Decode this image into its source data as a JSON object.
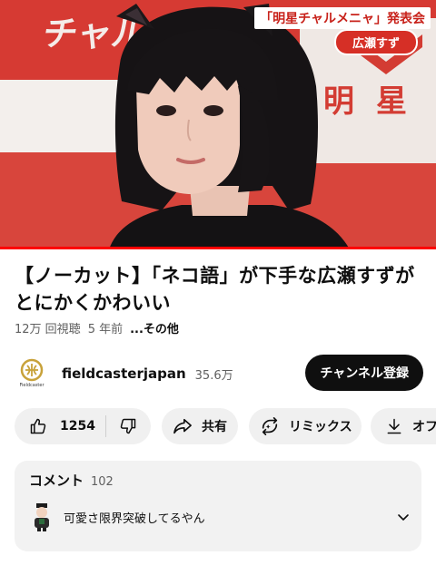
{
  "video": {
    "caption_event": "「明星チャルメニャ」発表会",
    "caption_name": "広瀬すず",
    "background_logo": "チャル",
    "background_brand": "明星",
    "progress": 1.0
  },
  "title": "【ノーカット】「ネコ語」が下手な広瀬すずがとにかくかわいい",
  "meta": {
    "views": "12万 回視聴",
    "age": "5 年前",
    "more": "...その他"
  },
  "channel": {
    "name": "fieldcasterjapan",
    "subscribers": "35.6万",
    "avatar_caption": "Fieldcaster",
    "subscribe_label": "チャンネル登録"
  },
  "actions": {
    "like_count": "1254",
    "share_label": "共有",
    "remix_label": "リミックス",
    "offline_label": "オフ"
  },
  "comments": {
    "title": "コメント",
    "count": "102",
    "top_comment": "可愛さ限界突破してるやん"
  },
  "colors": {
    "accent_red": "#ff0000",
    "chip_bg": "#f0f0f0",
    "subscribe_bg": "#0f0f0f",
    "logo_gold": "#c8a23a"
  },
  "icons": [
    "thumb-up-icon",
    "thumb-down-icon",
    "share-icon",
    "remix-icon",
    "download-icon",
    "chevron-down-icon"
  ]
}
